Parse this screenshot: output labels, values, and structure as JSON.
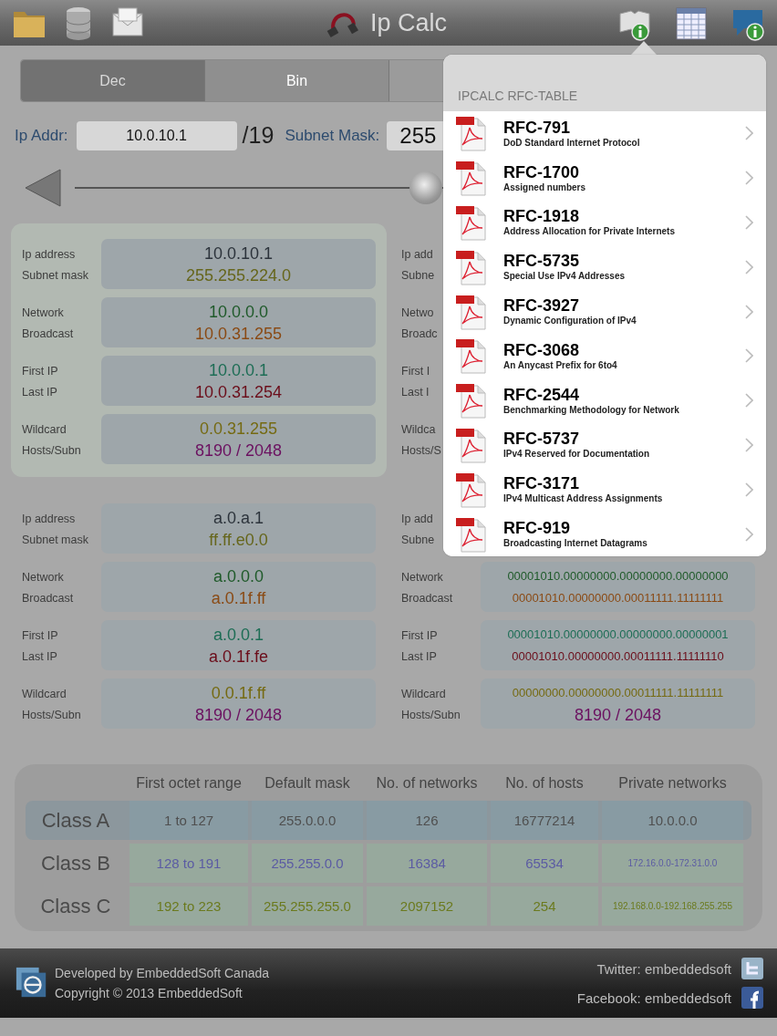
{
  "toolbar": {
    "title": "Ip Calc"
  },
  "tabs": [
    {
      "label": "Dec",
      "selected": true
    },
    {
      "label": "Bin",
      "selected": false
    }
  ],
  "ip_field": {
    "label": "Ip Addr:",
    "value": "10.0.10.1"
  },
  "prefix": "/19",
  "mask_field": {
    "label": "Subnet Mask:",
    "value": "255"
  },
  "slider": {
    "level": 0.56
  },
  "panels": [
    {
      "shaded": true,
      "rows": [
        {
          "labels": [
            "Ip address",
            "Subnet mask"
          ],
          "values": [
            {
              "text": "10.0.10.1",
              "color": "#2c333b",
              "kind": "plain"
            },
            {
              "text": "255.255.224.0",
              "color": "#66661c",
              "kind": "plain"
            }
          ]
        },
        {
          "labels": [
            "Network",
            "Broadcast"
          ],
          "values": [
            {
              "text": "10.0.0.0",
              "color": "#1f5a2a",
              "kind": "plain"
            },
            {
              "text": "10.0.31.255",
              "color": "#8a4a14",
              "kind": "plain"
            }
          ]
        },
        {
          "labels": [
            "First IP",
            "Last IP"
          ],
          "values": [
            {
              "text": "10.0.0.1",
              "color": "#1d6d55",
              "kind": "plain"
            },
            {
              "text": "10.0.31.254",
              "color": "#6b0d1a",
              "kind": "plain"
            }
          ]
        },
        {
          "labels": [
            "Wildcard",
            "Hosts/Subn"
          ],
          "values": [
            {
              "text": "0.0.31.255",
              "color": "#756a12",
              "kind": "plain"
            },
            {
              "text": "8190 / 2048",
              "color": "#6b1060",
              "kind": "plain"
            }
          ]
        }
      ]
    },
    {
      "shaded": false,
      "rows": [
        {
          "labels": [
            "Ip add",
            "Subne"
          ]
        },
        {
          "labels": [
            "Netwo",
            "Broadc"
          ]
        },
        {
          "labels": [
            "First I",
            "Last I"
          ]
        },
        {
          "labels": [
            "Wildca",
            "Hosts/S"
          ]
        }
      ]
    },
    {
      "shaded": false,
      "rows": [
        {
          "labels": [
            "Ip address",
            "Subnet mask"
          ],
          "values": [
            {
              "text": "a.0.a.1",
              "color": "#2c333b",
              "kind": "plain"
            },
            {
              "text": "ff.ff.e0.0",
              "color": "#66661c",
              "kind": "plain"
            }
          ]
        },
        {
          "labels": [
            "Network",
            "Broadcast"
          ],
          "values": [
            {
              "text": "a.0.0.0",
              "color": "#1f5a2a",
              "kind": "plain"
            },
            {
              "text": "a.0.1f.ff",
              "color": "#8a4a14",
              "kind": "plain"
            }
          ]
        },
        {
          "labels": [
            "First IP",
            "Last IP"
          ],
          "values": [
            {
              "text": "a.0.0.1",
              "color": "#1d6d55",
              "kind": "plain"
            },
            {
              "text": "a.0.1f.fe",
              "color": "#6b0d1a",
              "kind": "plain"
            }
          ]
        },
        {
          "labels": [
            "Wildcard",
            "Hosts/Subn"
          ],
          "values": [
            {
              "text": "0.0.1f.ff",
              "color": "#756a12",
              "kind": "plain"
            },
            {
              "text": "8190 / 2048",
              "color": "#6b1060",
              "kind": "plain"
            }
          ]
        }
      ]
    },
    {
      "shaded": false,
      "rows": [
        {
          "labels": [
            "Ip add",
            "Subne"
          ]
        },
        {
          "labels": [
            "Network",
            "Broadcast"
          ],
          "values": [
            {
              "text": "00001010.00000000.00000000.00000000",
              "color": "#1f5a2a",
              "kind": "bits"
            },
            {
              "text": "00001010.00000000.00011111.11111111",
              "color": "#8a4a14",
              "kind": "bits"
            }
          ]
        },
        {
          "labels": [
            "First IP",
            "Last IP"
          ],
          "values": [
            {
              "text": "00001010.00000000.00000000.00000001",
              "color": "#1d6d55",
              "kind": "bits"
            },
            {
              "text": "00001010.00000000.00011111.11111110",
              "color": "#6b0d1a",
              "kind": "bits"
            }
          ]
        },
        {
          "labels": [
            "Wildcard",
            "Hosts/Subn"
          ],
          "values": [
            {
              "text": "00000000.00000000.00011111.11111111",
              "color": "#756a12",
              "kind": "bits"
            },
            {
              "text": "8190 / 2048",
              "color": "#6b1060",
              "kind": "plain"
            }
          ]
        }
      ]
    }
  ],
  "class_table": {
    "columns": [
      "First octet range",
      "Default mask",
      "No. of networks",
      "No. of hosts",
      "Private networks"
    ],
    "rows": [
      {
        "label": "Class A",
        "selected": true,
        "color": "#4f4f4f",
        "cells": [
          "1 to 127",
          "255.0.0.0",
          "126",
          "16777214",
          "10.0.0.0"
        ]
      },
      {
        "label": "Class B",
        "selected": false,
        "color": "#5b5ba3",
        "cells": [
          "128 to 191",
          "255.255.0.0",
          "16384",
          "65534",
          "172.16.0.0-172.31.0.0"
        ]
      },
      {
        "label": "Class C",
        "selected": false,
        "color": "#6b7a1e",
        "cells": [
          "192 to 223",
          "255.255.255.0",
          "2097152",
          "254",
          "192.168.0.0-192.168.255.255"
        ]
      }
    ]
  },
  "footer": {
    "lines": [
      "Developed by EmbeddedSoft Canada",
      "Copyright © 2013 EmbeddedSoft"
    ],
    "twitter": "Twitter: embeddedsoft",
    "facebook": "Facebook: embeddedsoft"
  },
  "popover": {
    "title": "IPCALC RFC-TABLE",
    "items": [
      {
        "title": "RFC-791",
        "subtitle": "DoD Standard Internet Protocol"
      },
      {
        "title": "RFC-1700",
        "subtitle": "Assigned numbers"
      },
      {
        "title": "RFC-1918",
        "subtitle": "Address Allocation for Private Internets"
      },
      {
        "title": "RFC-5735",
        "subtitle": "Special Use IPv4 Addresses"
      },
      {
        "title": "RFC-3927",
        "subtitle": "Dynamic Configuration of IPv4"
      },
      {
        "title": "RFC-3068",
        "subtitle": "An Anycast Prefix for 6to4"
      },
      {
        "title": "RFC-2544",
        "subtitle": "Benchmarking Methodology for Network"
      },
      {
        "title": "RFC-5737",
        "subtitle": "IPv4 Reserved for Documentation"
      },
      {
        "title": "RFC-3171",
        "subtitle": "IPv4 Multicast Address Assignments"
      },
      {
        "title": "RFC-919",
        "subtitle": "Broadcasting Internet Datagrams"
      }
    ]
  }
}
